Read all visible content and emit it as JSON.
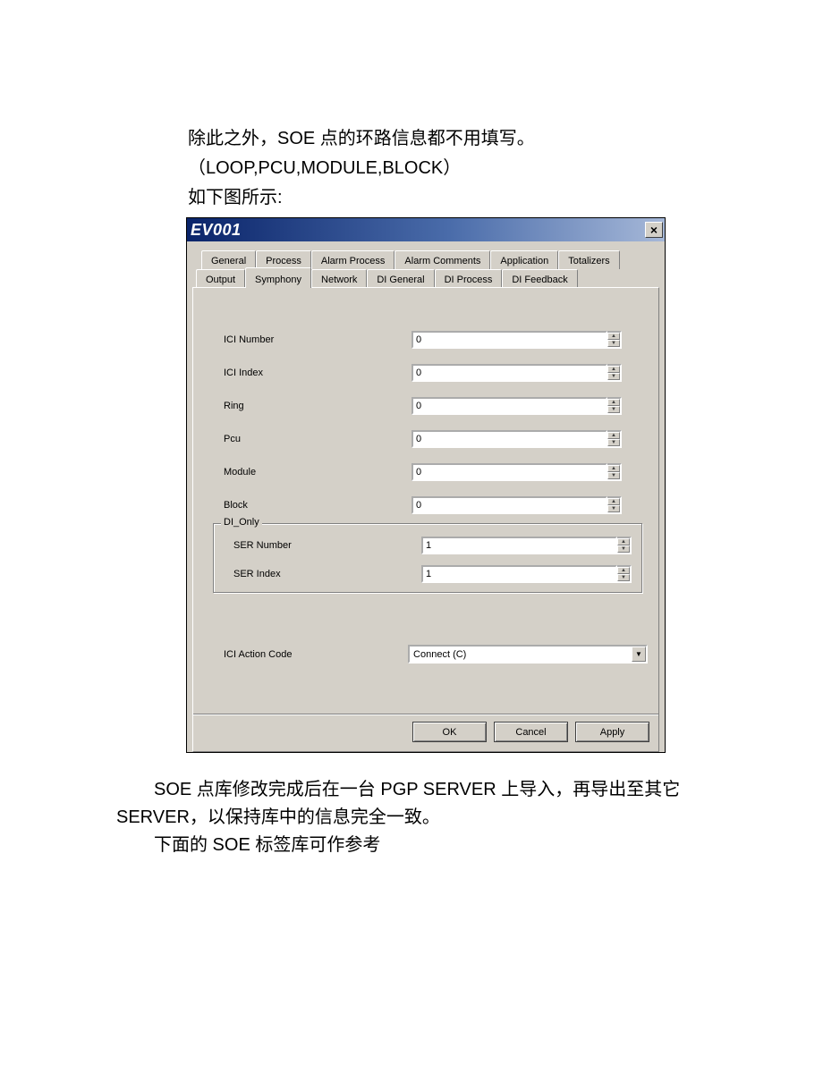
{
  "intro": {
    "line1": "除此之外，SOE 点的环路信息都不用填写。",
    "line2": "（LOOP,PCU,MODULE,BLOCK）",
    "line3": "如下图所示:"
  },
  "dialog": {
    "title": "EV001",
    "close_glyph": "×",
    "tabs_row1": [
      {
        "id": "general",
        "label": "General"
      },
      {
        "id": "process",
        "label": "Process"
      },
      {
        "id": "alarm-process",
        "label": "Alarm Process"
      },
      {
        "id": "alarm-comments",
        "label": "Alarm Comments"
      },
      {
        "id": "application",
        "label": "Application"
      },
      {
        "id": "totalizers",
        "label": "Totalizers"
      }
    ],
    "tabs_row2": [
      {
        "id": "output",
        "label": "Output"
      },
      {
        "id": "symphony",
        "label": "Symphony",
        "active": true
      },
      {
        "id": "network",
        "label": "Network"
      },
      {
        "id": "di-general",
        "label": "DI General"
      },
      {
        "id": "di-process",
        "label": "DI Process"
      },
      {
        "id": "di-feedback",
        "label": "DI Feedback"
      }
    ],
    "fields": {
      "ici_number": {
        "label": "ICI Number",
        "value": "0"
      },
      "ici_index": {
        "label": "ICI Index",
        "value": "0"
      },
      "ring": {
        "label": "Ring",
        "value": "0"
      },
      "pcu": {
        "label": "Pcu",
        "value": "0"
      },
      "module": {
        "label": "Module",
        "value": "0"
      },
      "block": {
        "label": "Block",
        "value": "0"
      }
    },
    "groupbox": {
      "title": "DI_Only",
      "ser_number": {
        "label": "SER Number",
        "value": "1"
      },
      "ser_index": {
        "label": "SER Index",
        "value": "1"
      }
    },
    "action_code": {
      "label": "ICI Action Code",
      "selected": "Connect (C)"
    },
    "buttons": {
      "ok": "OK",
      "cancel": "Cancel",
      "apply": "Apply"
    },
    "spin_up": "▲",
    "spin_down": "▼",
    "dropdown_arrow": "▼"
  },
  "outro": {
    "line1": "SOE 点库修改完成后在一台 PGP SERVER 上导入，再导出至其它",
    "line2": "SERVER，以保持库中的信息完全一致。",
    "line3": "下面的 SOE 标签库可作参考"
  }
}
